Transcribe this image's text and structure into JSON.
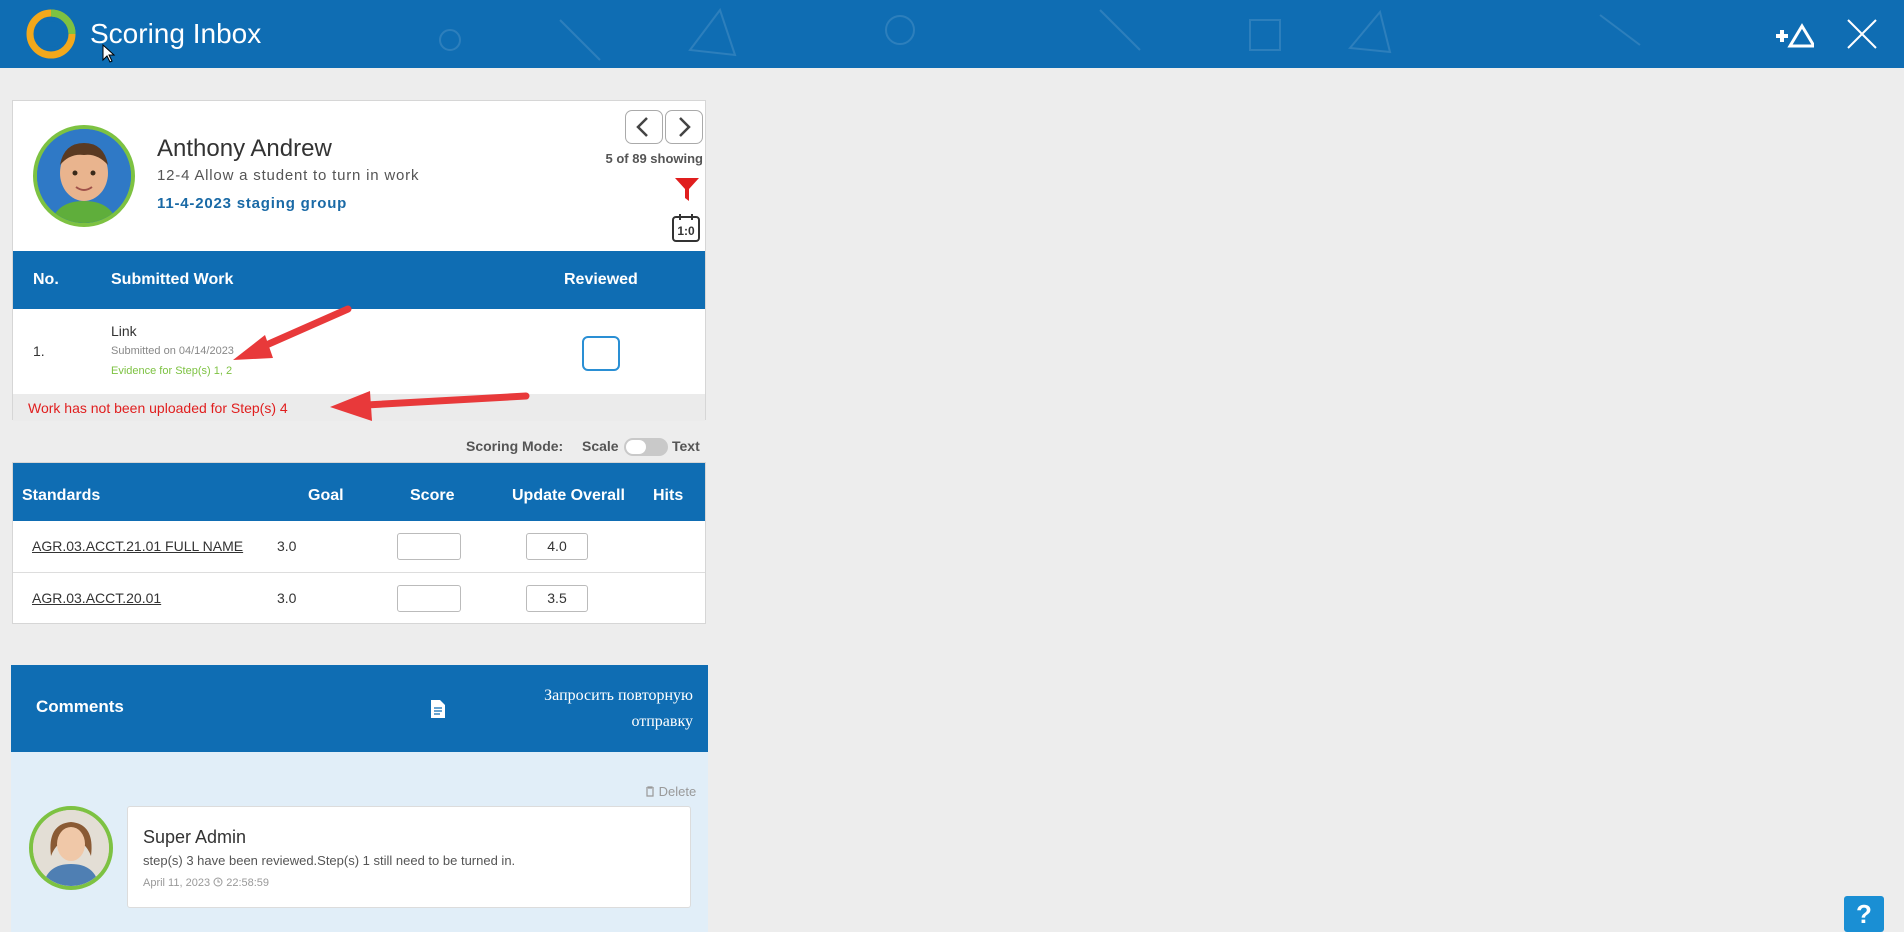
{
  "header": {
    "title": "Scoring Inbox",
    "add_assessment_icon": "plus-triangle-icon",
    "close_icon": "close-icon"
  },
  "student": {
    "name": "Anthony Andrew",
    "assignment": "12-4 Allow a student to turn in work",
    "group": "11-4-2023 staging group",
    "counter": "5 of 89 showing",
    "icons": [
      "chevron-left-icon",
      "chevron-right-icon",
      "filter-icon",
      "calendar-icon"
    ]
  },
  "submitted_work": {
    "columns": [
      "No.",
      "Submitted Work",
      "Reviewed"
    ],
    "rows": [
      {
        "no": "1.",
        "type": "Link",
        "date": "Submitted on 04/14/2023",
        "evidence": "Evidence for Step(s) 1, 2",
        "reviewed": false
      }
    ],
    "warning": "Work has not been uploaded for Step(s) 4"
  },
  "scoring_mode": {
    "label": "Scoring Mode:",
    "option_left": "Scale",
    "option_right": "Text",
    "selected": "Scale"
  },
  "standards": {
    "columns": [
      "Standards",
      "Goal",
      "Score",
      "Update Overall",
      "Hits"
    ],
    "rows": [
      {
        "name": "AGR.03.ACCT.21.01 FULL NAME",
        "goal": "3.0",
        "score": "",
        "overall": "4.0"
      },
      {
        "name": "AGR.03.ACCT.20.01",
        "goal": "3.0",
        "score": "",
        "overall": "3.5"
      }
    ]
  },
  "comments": {
    "title": "Comments",
    "resubmit_line1": "Запросить повторную",
    "resubmit_line2": "отправку",
    "delete_label": "Delete",
    "items": [
      {
        "author": "Super Admin",
        "text": "step(s) 3 have been reviewed.Step(s) 1 still need to be turned in.",
        "date": "April 11, 2023",
        "time": "22:58:59"
      }
    ]
  },
  "help": {
    "label": "?"
  },
  "colors": {
    "header_blue": "#0f6db3",
    "accent_green": "#7dc242",
    "warning_red": "#e01e1e",
    "link_blue": "#1a6aa6",
    "annotation_arrow": "#e8393a"
  }
}
